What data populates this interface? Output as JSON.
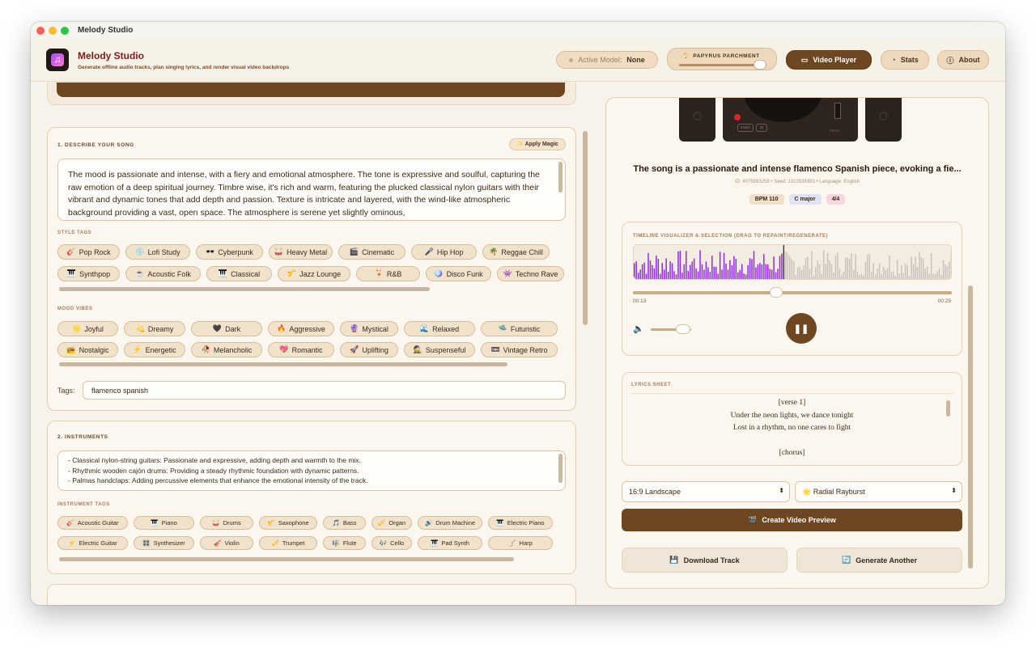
{
  "window": {
    "title": "Melody Studio"
  },
  "header": {
    "app_title": "Melody Studio",
    "subtitle": "Generate offline audio tracks, plan singing lyrics, and render visual video backdrops",
    "active_model_label": "Active Model:",
    "active_model_value": "None",
    "theme_label": "PAPYRUS PARCHMENT",
    "theme_level": 1.0,
    "video_player_label": "Video Player",
    "stats_label": "Stats",
    "about_label": "About"
  },
  "describe": {
    "title": "1. DESCRIBE YOUR SONG",
    "apply_magic": "Apply Magic",
    "description": "The mood is passionate and intense, with a fiery and emotional atmosphere. The tone is expressive and soulful, capturing the raw emotion of a deep spiritual journey. Timbre wise, it's rich and warm, featuring the plucked classical nylon guitars with their vibrant and dynamic tones that add depth and passion. Texture is intricate and layered, with the wind-like atmospheric background providing a vast, open space. The atmosphere is serene yet slightly ominous,",
    "style_tags_label": "STYLE TAGS",
    "style_tags_row1": [
      {
        "icon": "🎸",
        "label": "Pop Rock"
      },
      {
        "icon": "💿",
        "label": "Lofi Study"
      },
      {
        "icon": "🕶️",
        "label": "Cyberpunk"
      },
      {
        "icon": "🥁",
        "label": "Heavy Metal"
      },
      {
        "icon": "🎬",
        "label": "Cinematic"
      },
      {
        "icon": "🎤",
        "label": "Hip Hop"
      },
      {
        "icon": "🌴",
        "label": "Reggae Chill"
      }
    ],
    "style_tags_row2": [
      {
        "icon": "🎹",
        "label": "Synthpop"
      },
      {
        "icon": "☕",
        "label": "Acoustic Folk"
      },
      {
        "icon": "🎹",
        "label": "Classical"
      },
      {
        "icon": "🎷",
        "label": "Jazz Lounge"
      },
      {
        "icon": "🍹",
        "label": "R&B"
      },
      {
        "icon": "🪩",
        "label": "Disco Funk"
      },
      {
        "icon": "👾",
        "label": "Techno Rave"
      }
    ],
    "mood_label": "MOOD VIBES",
    "mood_row1": [
      {
        "icon": "🌟",
        "label": "Joyful"
      },
      {
        "icon": "💫",
        "label": "Dreamy"
      },
      {
        "icon": "🖤",
        "label": "Dark"
      },
      {
        "icon": "🔥",
        "label": "Aggressive"
      },
      {
        "icon": "🔮",
        "label": "Mystical"
      },
      {
        "icon": "🌊",
        "label": "Relaxed"
      },
      {
        "icon": "🛸",
        "label": "Futuristic"
      }
    ],
    "mood_row2": [
      {
        "icon": "📻",
        "label": "Nostalgic"
      },
      {
        "icon": "⚡",
        "label": "Energetic"
      },
      {
        "icon": "🥀",
        "label": "Melancholic"
      },
      {
        "icon": "💖",
        "label": "Romantic"
      },
      {
        "icon": "🚀",
        "label": "Uplifting"
      },
      {
        "icon": "🕵️",
        "label": "Suspenseful"
      },
      {
        "icon": "📼",
        "label": "Vintage Retro"
      }
    ],
    "tags_label": "Tags:",
    "tags_value": "flamenco spanish"
  },
  "instruments": {
    "title": "2. INSTRUMENTS",
    "text_lines": [
      "- Classical nylon-string guitars: Passionate and expressive, adding depth and warmth to the mix.",
      "- Rhythmic wooden cajón drums: Providing a steady rhythmic foundation with dynamic patterns.",
      "- Palmas handclaps: Adding percussive elements that enhance the emotional intensity of the track."
    ],
    "tags_label": "INSTRUMENT TAGS",
    "row1": [
      {
        "icon": "🎸",
        "label": "Acoustic Guitar"
      },
      {
        "icon": "🎹",
        "label": "Piano"
      },
      {
        "icon": "🥁",
        "label": "Drums"
      },
      {
        "icon": "🎷",
        "label": "Saxophone"
      },
      {
        "icon": "🎵",
        "label": "Bass"
      },
      {
        "icon": "🎺",
        "label": "Organ"
      },
      {
        "icon": "🔊",
        "label": "Drum Machine"
      },
      {
        "icon": "🎹",
        "label": "Electric Piano"
      }
    ],
    "row2": [
      {
        "icon": "⚡",
        "label": "Electric Guitar"
      },
      {
        "icon": "🎛️",
        "label": "Synthesizer"
      },
      {
        "icon": "🎻",
        "label": "Violin"
      },
      {
        "icon": "🎺",
        "label": "Trumpet"
      },
      {
        "icon": "🎼",
        "label": "Flute"
      },
      {
        "icon": "🎶",
        "label": "Cello"
      },
      {
        "icon": "🎹",
        "label": "Pad Synth"
      },
      {
        "icon": "🪕",
        "label": "Harp"
      }
    ]
  },
  "player": {
    "song_title": "The song is a passionate and intense flamenco Spanish piece, evoking a fie...",
    "meta": "ID: 4075563258 • Seed: 1310538383 • Language: English",
    "bpm": "BPM 110",
    "key": "C major",
    "time_sig": "4/4",
    "timeline_label": "TIMELINE VISUALIZER & SELECTION (DRAG TO REPAINT/REGENERATE)",
    "time_current": "00:13",
    "time_total": "00:29",
    "progress": 0.45,
    "volume": 0.8,
    "play_icon": "pause-icon",
    "lyrics_label": "LYRICS SHEET",
    "lyrics": [
      "[verse 1]",
      "Under the neon lights, we dance tonight",
      "Lost in a rhythm, no one cares to fight",
      "",
      "[chorus]"
    ],
    "aspect_select": "16:9 Landscape",
    "visual_select": "Radial Rayburst",
    "create_video": "Create Video Preview",
    "download": "Download Track",
    "generate_another": "Generate Another"
  },
  "colors": {
    "accent": "#6e4620",
    "background": "#f8f3ea",
    "wave_played": "#8a2be2",
    "wave_unplayed": "#c8c3bc"
  }
}
